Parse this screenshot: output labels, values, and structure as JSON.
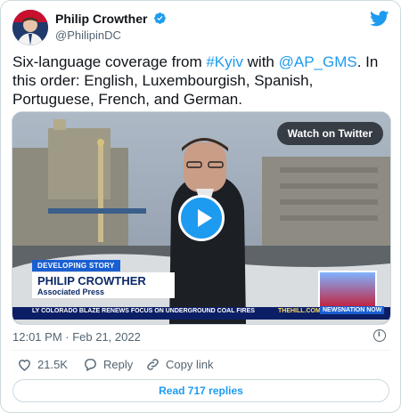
{
  "author": {
    "name": "Philip Crowther",
    "handle": "@PhilipinDC"
  },
  "tweet": {
    "parts": [
      {
        "text": "Six-language coverage from ",
        "link": false
      },
      {
        "text": "#Kyiv",
        "link": true
      },
      {
        "text": " with ",
        "link": false
      },
      {
        "text": "@AP_GMS",
        "link": true
      },
      {
        "text": ". In this order: English, Luxembourgish, Spanish, Portuguese, French, and German.",
        "link": false
      }
    ]
  },
  "media": {
    "watch_label": "Watch on Twitter",
    "lower_third": {
      "tag": "DEVELOPING STORY",
      "name": "PHILIP CROWTHER",
      "affiliation": "Associated Press",
      "ticker": "LY COLORADO BLAZE RENEWS FOCUS ON UNDERGROUND COAL FIRES",
      "site": "THEHILL.COM",
      "network": "NEWSNATION NOW"
    }
  },
  "timestamp": "12:01 PM · Feb 21, 2022",
  "actions": {
    "likes": "21.5K",
    "reply": "Reply",
    "copy": "Copy link"
  },
  "read_replies": "Read 717 replies",
  "colors": {
    "accent": "#1d9bf0",
    "text": "#0f1419",
    "muted": "#536471"
  }
}
